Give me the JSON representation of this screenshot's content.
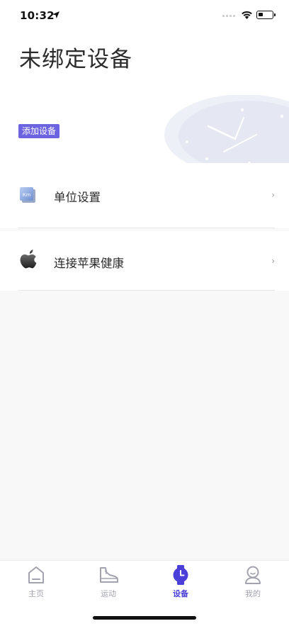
{
  "status_bar": {
    "time": "10:32",
    "battery_level": 0.35
  },
  "header": {
    "title": "未绑定设备",
    "add_device_label": "添加设备"
  },
  "settings": [
    {
      "label": "单位设置",
      "icon": "km-unit-icon",
      "icon_text": "Km",
      "chevron": "›"
    },
    {
      "label": "连接苹果健康",
      "icon": "apple-logo-icon",
      "chevron": "›"
    }
  ],
  "tabbar": {
    "tabs": [
      {
        "label": "主页",
        "icon": "home-icon",
        "active": false
      },
      {
        "label": "运动",
        "icon": "sneaker-icon",
        "active": false
      },
      {
        "label": "设备",
        "icon": "watch-icon",
        "active": true
      },
      {
        "label": "我的",
        "icon": "profile-icon",
        "active": false
      }
    ]
  },
  "colors": {
    "accent": "#4b3fd9",
    "badge": "#6c63e0",
    "inactive": "#a3a3b0",
    "background": "#f8f8f9"
  }
}
